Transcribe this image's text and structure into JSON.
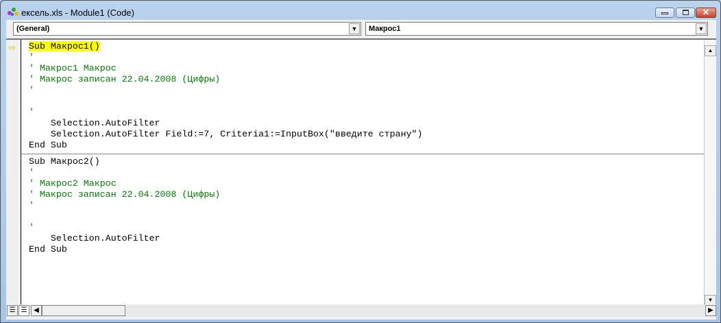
{
  "window": {
    "title": "ексель.xls - Module1 (Code)"
  },
  "object_combo": {
    "value": "(General)"
  },
  "proc_combo": {
    "value": "Макрос1"
  },
  "code": {
    "block1": [
      {
        "text": "Sub Макрос1()",
        "type": "code",
        "highlight": true
      },
      {
        "text": "'",
        "type": "comment"
      },
      {
        "text": "' Макрос1 Макрос",
        "type": "comment"
      },
      {
        "text": "' Макрос записан 22.04.2008 (Цифры)",
        "type": "comment"
      },
      {
        "text": "'",
        "type": "comment"
      },
      {
        "text": "",
        "type": "code"
      },
      {
        "text": "'",
        "type": "comment"
      },
      {
        "text": "    Selection.AutoFilter",
        "type": "code"
      },
      {
        "text": "    Selection.AutoFilter Field:=7, Criteria1:=InputBox(\"введите страну\")",
        "type": "code"
      },
      {
        "text": "End Sub",
        "type": "code"
      }
    ],
    "block2": [
      {
        "text": "Sub Макрос2()",
        "type": "code"
      },
      {
        "text": "'",
        "type": "comment"
      },
      {
        "text": "' Макрос2 Макрос",
        "type": "comment"
      },
      {
        "text": "' Макрос записан 22.04.2008 (Цифры)",
        "type": "comment"
      },
      {
        "text": "'",
        "type": "comment"
      },
      {
        "text": "",
        "type": "code"
      },
      {
        "text": "'",
        "type": "comment"
      },
      {
        "text": "    Selection.AutoFilter",
        "type": "code"
      },
      {
        "text": "End Sub",
        "type": "code"
      }
    ]
  }
}
